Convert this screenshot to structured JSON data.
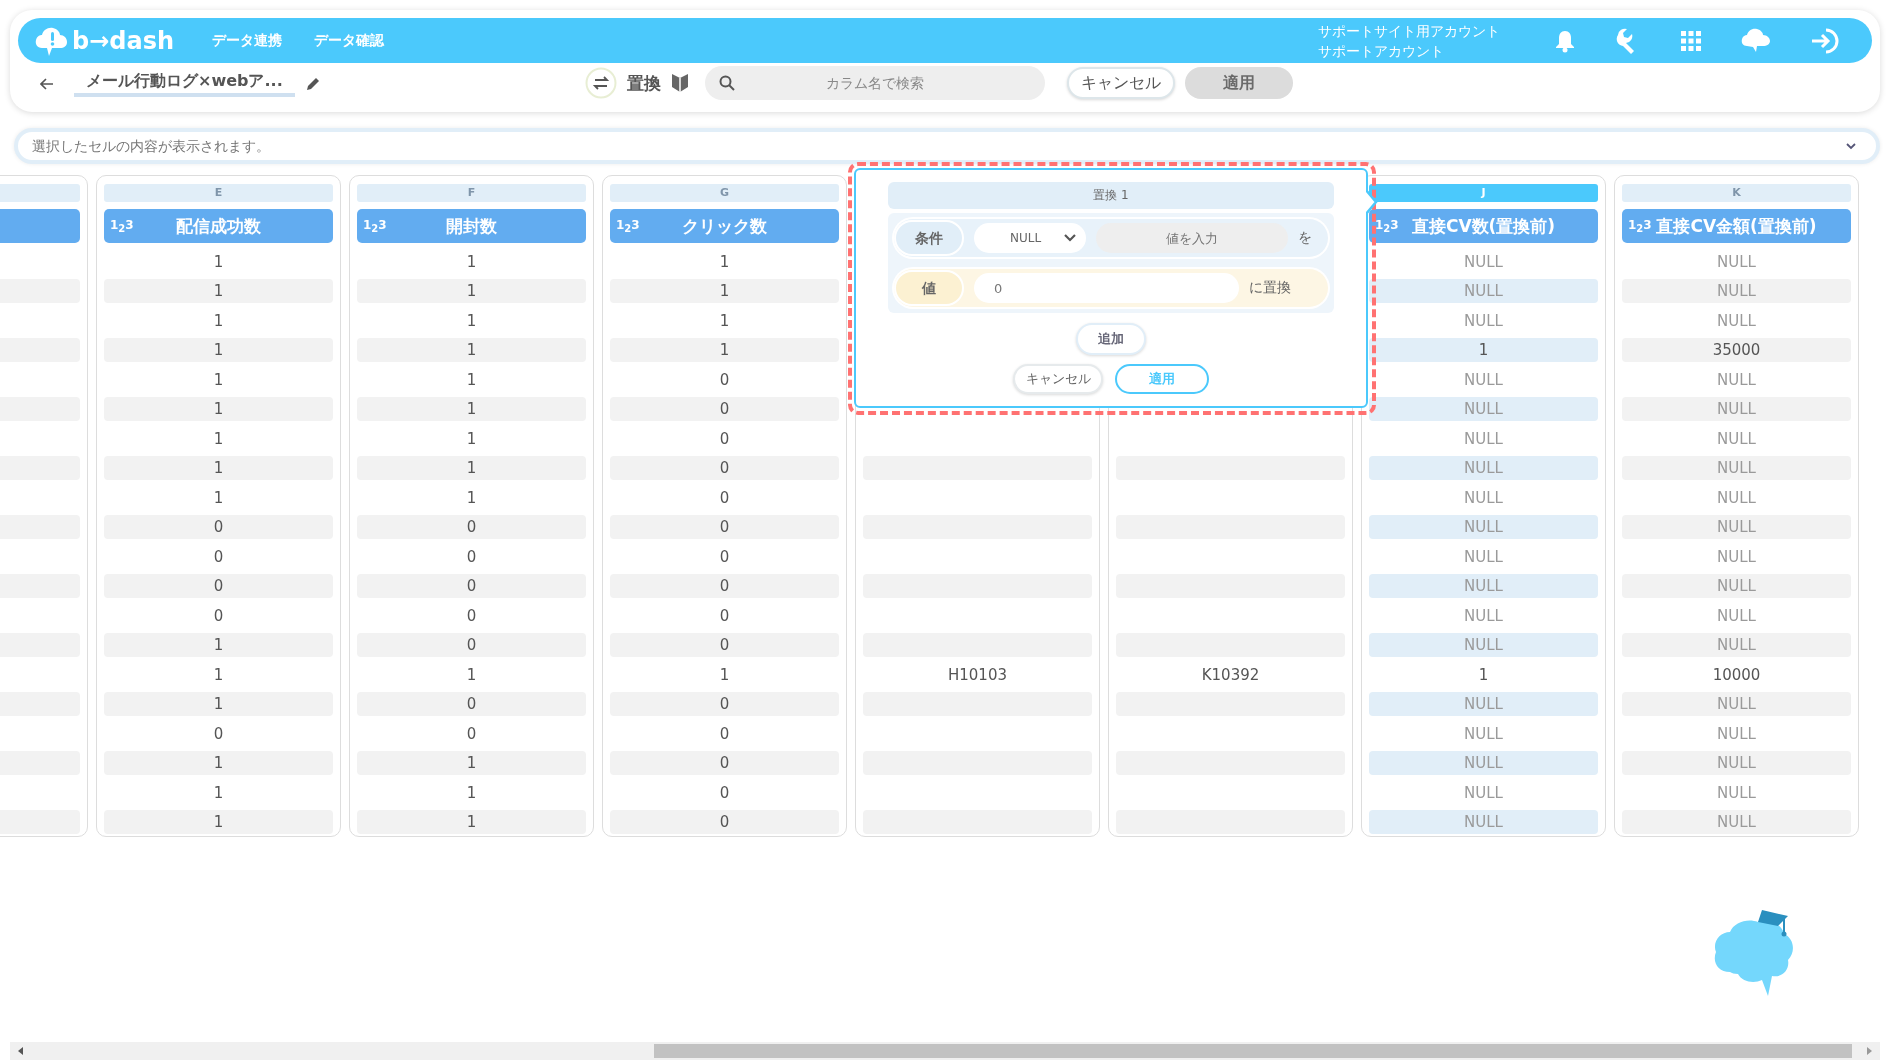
{
  "header": {
    "logo": "b→dash",
    "nav": [
      "データ連携",
      "データ確認"
    ],
    "account": [
      "サポートサイト用アカウント",
      "サポートアカウント"
    ]
  },
  "toolbar": {
    "title": "メール行動ログ×webア...",
    "mode": "置換",
    "search": {
      "placeholder": "カラム名で検索"
    },
    "cancel": "キャンセル",
    "apply": "適用"
  },
  "cell_viewer": {
    "placeholder": "選択したセルの内容が表示されます。"
  },
  "columns": [
    {
      "selected": false,
      "cells": [
        null,
        null,
        null,
        null,
        null,
        null,
        null,
        null,
        null,
        null,
        null,
        null,
        null,
        null,
        null,
        null,
        null,
        null,
        null,
        null
      ]
    },
    {
      "letter": "E",
      "type": "1$_{2}$3",
      "name": "配信成功数",
      "selected": false,
      "cells": [
        "1",
        "1",
        "1",
        "1",
        "1",
        "1",
        "1",
        "1",
        "1",
        "0",
        "0",
        "0",
        "0",
        "1",
        "1",
        "1",
        "0",
        "1",
        "1",
        "1"
      ]
    },
    {
      "letter": "F",
      "type": "1$_{2}$3",
      "name": "開封数",
      "selected": false,
      "cells": [
        "1",
        "1",
        "1",
        "1",
        "1",
        "1",
        "1",
        "1",
        "1",
        "0",
        "0",
        "0",
        "0",
        "0",
        "1",
        "0",
        "0",
        "1",
        "1",
        "1"
      ]
    },
    {
      "letter": "G",
      "type": "1$_{2}$3",
      "name": "クリック数",
      "selected": false,
      "cells": [
        "1",
        "1",
        "1",
        "1",
        "0",
        "0",
        "0",
        "0",
        "0",
        "0",
        "0",
        "0",
        "0",
        "0",
        "1",
        "0",
        "0",
        "0",
        "0",
        "0"
      ]
    },
    {
      "cells": [
        null,
        null,
        null,
        null,
        null,
        null,
        null,
        null,
        null,
        null,
        null,
        null,
        null,
        null,
        "H10103",
        null,
        null,
        null,
        null,
        null
      ]
    },
    {
      "cells": [
        null,
        null,
        null,
        null,
        null,
        null,
        null,
        null,
        null,
        null,
        null,
        null,
        null,
        null,
        "K10392",
        null,
        null,
        null,
        null,
        null
      ]
    },
    {
      "letter": "J",
      "type": "1$_{2}$3",
      "name": "直接CV数(置換前)",
      "selected": true,
      "cells": [
        {
          "v": "NULL",
          "is_null": true
        },
        {
          "v": "NULL",
          "is_null": true
        },
        {
          "v": "NULL",
          "is_null": true
        },
        "1",
        {
          "v": "NULL",
          "is_null": true
        },
        {
          "v": "NULL",
          "is_null": true
        },
        {
          "v": "NULL",
          "is_null": true
        },
        {
          "v": "NULL",
          "is_null": true
        },
        {
          "v": "NULL",
          "is_null": true
        },
        {
          "v": "NULL",
          "is_null": true
        },
        {
          "v": "NULL",
          "is_null": true
        },
        {
          "v": "NULL",
          "is_null": true
        },
        {
          "v": "NULL",
          "is_null": true
        },
        {
          "v": "NULL",
          "is_null": true
        },
        "1",
        {
          "v": "NULL",
          "is_null": true
        },
        {
          "v": "NULL",
          "is_null": true
        },
        {
          "v": "NULL",
          "is_null": true
        },
        {
          "v": "NULL",
          "is_null": true
        },
        {
          "v": "NULL",
          "is_null": true
        }
      ]
    },
    {
      "letter": "K",
      "type": "1$_{2}$3",
      "name": "直接CV金額(置換前)",
      "selected": false,
      "cells": [
        {
          "v": "NULL",
          "is_null": true
        },
        {
          "v": "NULL",
          "is_null": true
        },
        {
          "v": "NULL",
          "is_null": true
        },
        "35000",
        {
          "v": "NULL",
          "is_null": true
        },
        {
          "v": "NULL",
          "is_null": true
        },
        {
          "v": "NULL",
          "is_null": true
        },
        {
          "v": "NULL",
          "is_null": true
        },
        {
          "v": "NULL",
          "is_null": true
        },
        {
          "v": "NULL",
          "is_null": true
        },
        {
          "v": "NULL",
          "is_null": true
        },
        {
          "v": "NULL",
          "is_null": true
        },
        {
          "v": "NULL",
          "is_null": true
        },
        {
          "v": "NULL",
          "is_null": true
        },
        "10000",
        {
          "v": "NULL",
          "is_null": true
        },
        {
          "v": "NULL",
          "is_null": true
        },
        {
          "v": "NULL",
          "is_null": true
        },
        {
          "v": "NULL",
          "is_null": true
        },
        {
          "v": "NULL",
          "is_null": true
        }
      ]
    }
  ],
  "replace_popup": {
    "title": "置換 1",
    "condition": {
      "label": "条件",
      "operator": "NULL",
      "value": {
        "placeholder": "値を入力"
      },
      "suffix": "を"
    },
    "replacement": {
      "label": "値",
      "value": "0",
      "suffix": "に置換"
    },
    "add": "追加",
    "cancel": "キャンセル",
    "apply": "適用"
  }
}
